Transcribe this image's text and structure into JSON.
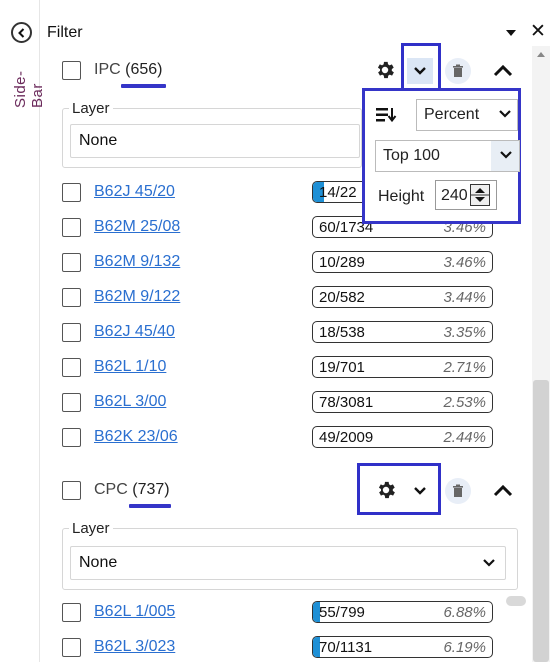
{
  "sidebar": {
    "label": "Side-Bar"
  },
  "panel": {
    "title": "Filter"
  },
  "sections": [
    {
      "name": "IPC",
      "count": "(656)",
      "layer_label": "Layer",
      "layer_value": "None",
      "rows": [
        {
          "code": "B62J 45/20",
          "ratio": "14/22",
          "fill": 0.06
        },
        {
          "code": "B62M 25/08",
          "ratio": "60/1734",
          "pct": "3.46%",
          "fill": 0.0
        },
        {
          "code": "B62M 9/132",
          "ratio": "10/289",
          "pct": "3.46%",
          "fill": 0.0
        },
        {
          "code": "B62M 9/122",
          "ratio": "20/582",
          "pct": "3.44%",
          "fill": 0.0
        },
        {
          "code": "B62J 45/40",
          "ratio": "18/538",
          "pct": "3.35%",
          "fill": 0.0
        },
        {
          "code": "B62L 1/10",
          "ratio": "19/701",
          "pct": "2.71%",
          "fill": 0.0
        },
        {
          "code": "B62L 3/00",
          "ratio": "78/3081",
          "pct": "2.53%",
          "fill": 0.0
        },
        {
          "code": "B62K 23/06",
          "ratio": "49/2009",
          "pct": "2.44%",
          "fill": 0.0
        }
      ]
    },
    {
      "name": "CPC",
      "count": "(737)",
      "layer_label": "Layer",
      "layer_value": "None",
      "rows": [
        {
          "code": "B62L 1/005",
          "ratio": "55/799",
          "pct": "6.88%",
          "fill": 0.04
        },
        {
          "code": "B62L 3/023",
          "ratio": "70/1131",
          "pct": "6.19%",
          "fill": 0.04
        }
      ]
    }
  ],
  "popup": {
    "mode": "Percent",
    "top": "Top 100",
    "height_label": "Height",
    "height_value": "240"
  },
  "colors": {
    "accent": "#3535c8",
    "link": "#2a6fd0",
    "bar": "#1e90d6"
  }
}
